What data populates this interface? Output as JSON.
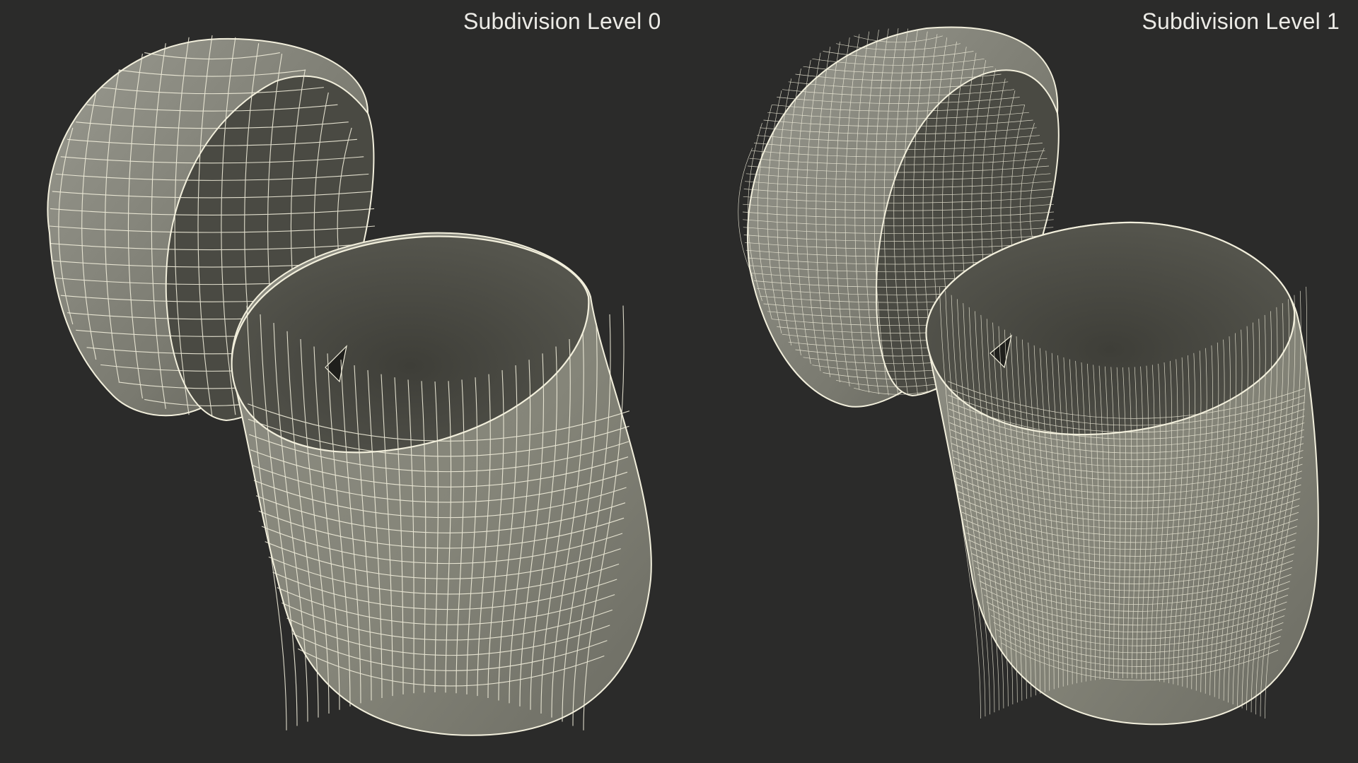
{
  "views": [
    {
      "id": "left",
      "label": "Subdivision Level 0",
      "lid_rings": 14,
      "lid_meridians": 22,
      "cup_rings": 18,
      "cup_meridians": 30
    },
    {
      "id": "right",
      "label": "Subdivision Level 1",
      "lid_rings": 32,
      "lid_meridians": 48,
      "cup_rings": 40,
      "cup_meridians": 64
    }
  ],
  "colors": {
    "background": "#2b2b2a",
    "surface_light": "#8a8a80",
    "surface_dark": "#55554d",
    "interior": "#4a4a43",
    "wire": "#f2efdc"
  }
}
